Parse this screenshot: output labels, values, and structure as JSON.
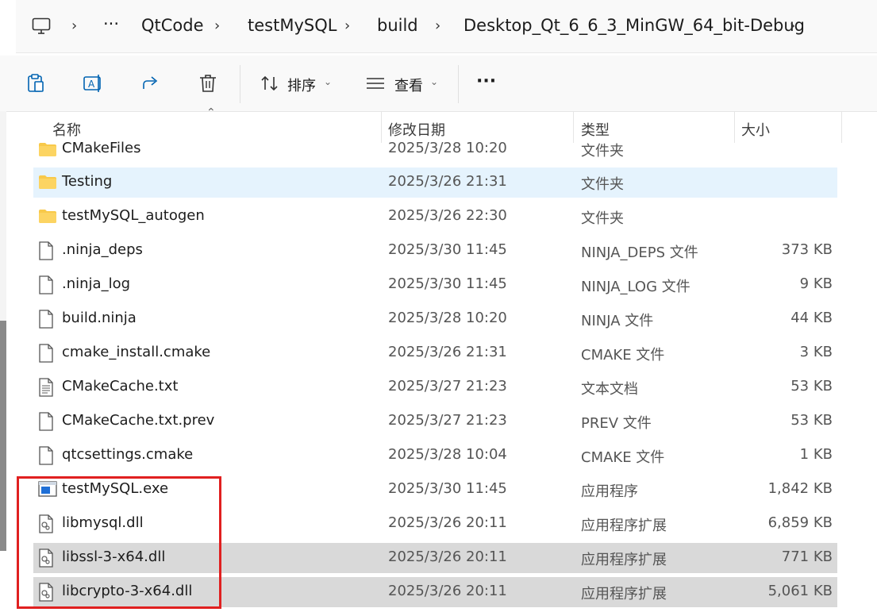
{
  "address_bar": {
    "crumbs": [
      "QtCode",
      "testMySQL",
      "build",
      "Desktop_Qt_6_6_3_MinGW_64_bit-Debug"
    ],
    "ellipsis": "···",
    "separator": "›"
  },
  "toolbar": {
    "sort_label": "排序",
    "view_label": "查看",
    "more_label": "···"
  },
  "columns": {
    "name": "名称",
    "date": "修改日期",
    "type": "类型",
    "size": "大小"
  },
  "files": [
    {
      "name": "CMakeFiles",
      "date": "2025/3/28 10:20",
      "type": "文件夹",
      "size": "",
      "icon": "folder-icon"
    },
    {
      "name": "Testing",
      "date": "2025/3/26 21:31",
      "type": "文件夹",
      "size": "",
      "icon": "folder-icon"
    },
    {
      "name": "testMySQL_autogen",
      "date": "2025/3/26 22:30",
      "type": "文件夹",
      "size": "",
      "icon": "folder-icon"
    },
    {
      "name": ".ninja_deps",
      "date": "2025/3/30 11:45",
      "type": "NINJA_DEPS 文件",
      "size": "373 KB",
      "icon": "file-icon"
    },
    {
      "name": ".ninja_log",
      "date": "2025/3/30 11:45",
      "type": "NINJA_LOG 文件",
      "size": "9 KB",
      "icon": "file-icon"
    },
    {
      "name": "build.ninja",
      "date": "2025/3/28 10:20",
      "type": "NINJA 文件",
      "size": "44 KB",
      "icon": "file-icon"
    },
    {
      "name": "cmake_install.cmake",
      "date": "2025/3/26 21:31",
      "type": "CMAKE 文件",
      "size": "3 KB",
      "icon": "file-icon"
    },
    {
      "name": "CMakeCache.txt",
      "date": "2025/3/27 21:23",
      "type": "文本文档",
      "size": "53 KB",
      "icon": "text-file-icon"
    },
    {
      "name": "CMakeCache.txt.prev",
      "date": "2025/3/27 21:23",
      "type": "PREV 文件",
      "size": "53 KB",
      "icon": "file-icon"
    },
    {
      "name": "qtcsettings.cmake",
      "date": "2025/3/28 10:04",
      "type": "CMAKE 文件",
      "size": "1 KB",
      "icon": "file-icon"
    },
    {
      "name": "testMySQL.exe",
      "date": "2025/3/30 11:45",
      "type": "应用程序",
      "size": "1,842 KB",
      "icon": "exe-icon"
    },
    {
      "name": "libmysql.dll",
      "date": "2025/3/26 20:11",
      "type": "应用程序扩展",
      "size": "6,859 KB",
      "icon": "dll-icon"
    },
    {
      "name": "libssl-3-x64.dll",
      "date": "2025/3/26 20:11",
      "type": "应用程序扩展",
      "size": "771 KB",
      "icon": "dll-icon"
    },
    {
      "name": "libcrypto-3-x64.dll",
      "date": "2025/3/26 20:11",
      "type": "应用程序扩展",
      "size": "5,061 KB",
      "icon": "dll-icon"
    }
  ],
  "colors": {
    "hover_row": "#e5f3fd",
    "selected_row": "#d9d9d9",
    "highlight_box": "#e02020",
    "folder": "#f8c94a"
  }
}
